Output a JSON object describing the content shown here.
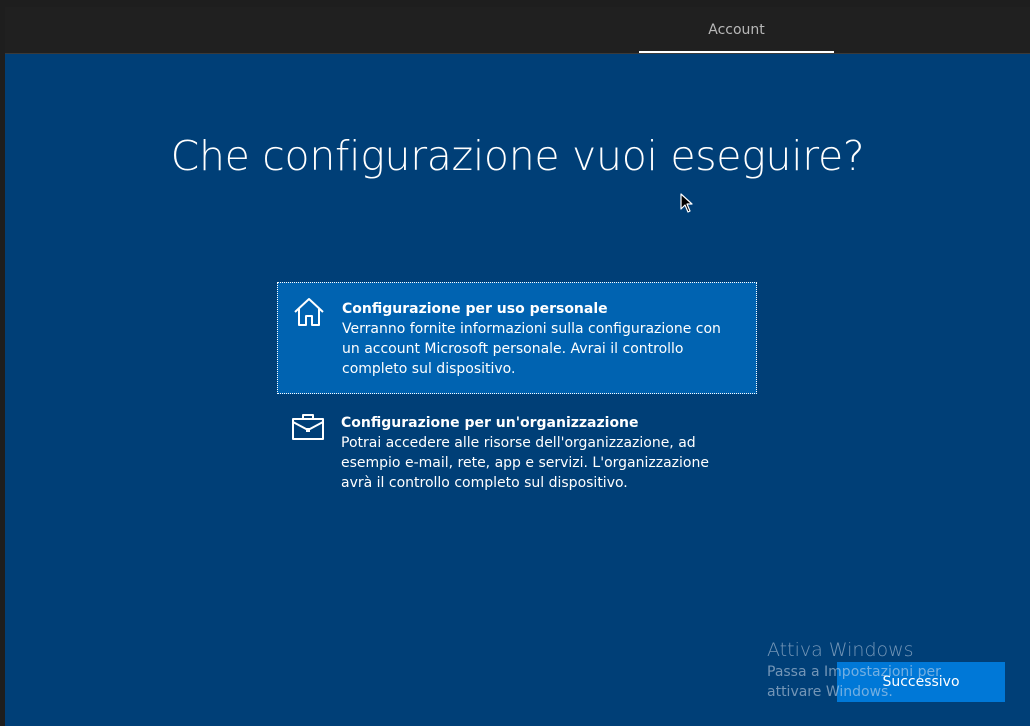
{
  "header": {
    "tab_label": "Account"
  },
  "page": {
    "title": "Che configurazione vuoi eseguire?"
  },
  "options": [
    {
      "icon": "home-icon",
      "title": "Configurazione per uso personale",
      "description": "Verranno fornite informazioni sulla configurazione con un account Microsoft personale. Avrai il controllo completo sul dispositivo.",
      "selected": true
    },
    {
      "icon": "briefcase-icon",
      "title": "Configurazione per un'organizzazione",
      "description": "Potrai accedere alle risorse dell'organizzazione, ad esempio e-mail, rete, app e servizi. L'organizzazione avrà il controllo completo sul dispositivo.",
      "selected": false
    }
  ],
  "footer": {
    "next_label": "Successivo"
  },
  "watermark": {
    "title": "Attiva Windows",
    "subtitle": "Passa a Impostazioni per attivare Windows."
  },
  "colors": {
    "background": "#003f77",
    "selected_option": "#0063b1",
    "accent_button": "#0078d7",
    "topbar": "#202020"
  }
}
